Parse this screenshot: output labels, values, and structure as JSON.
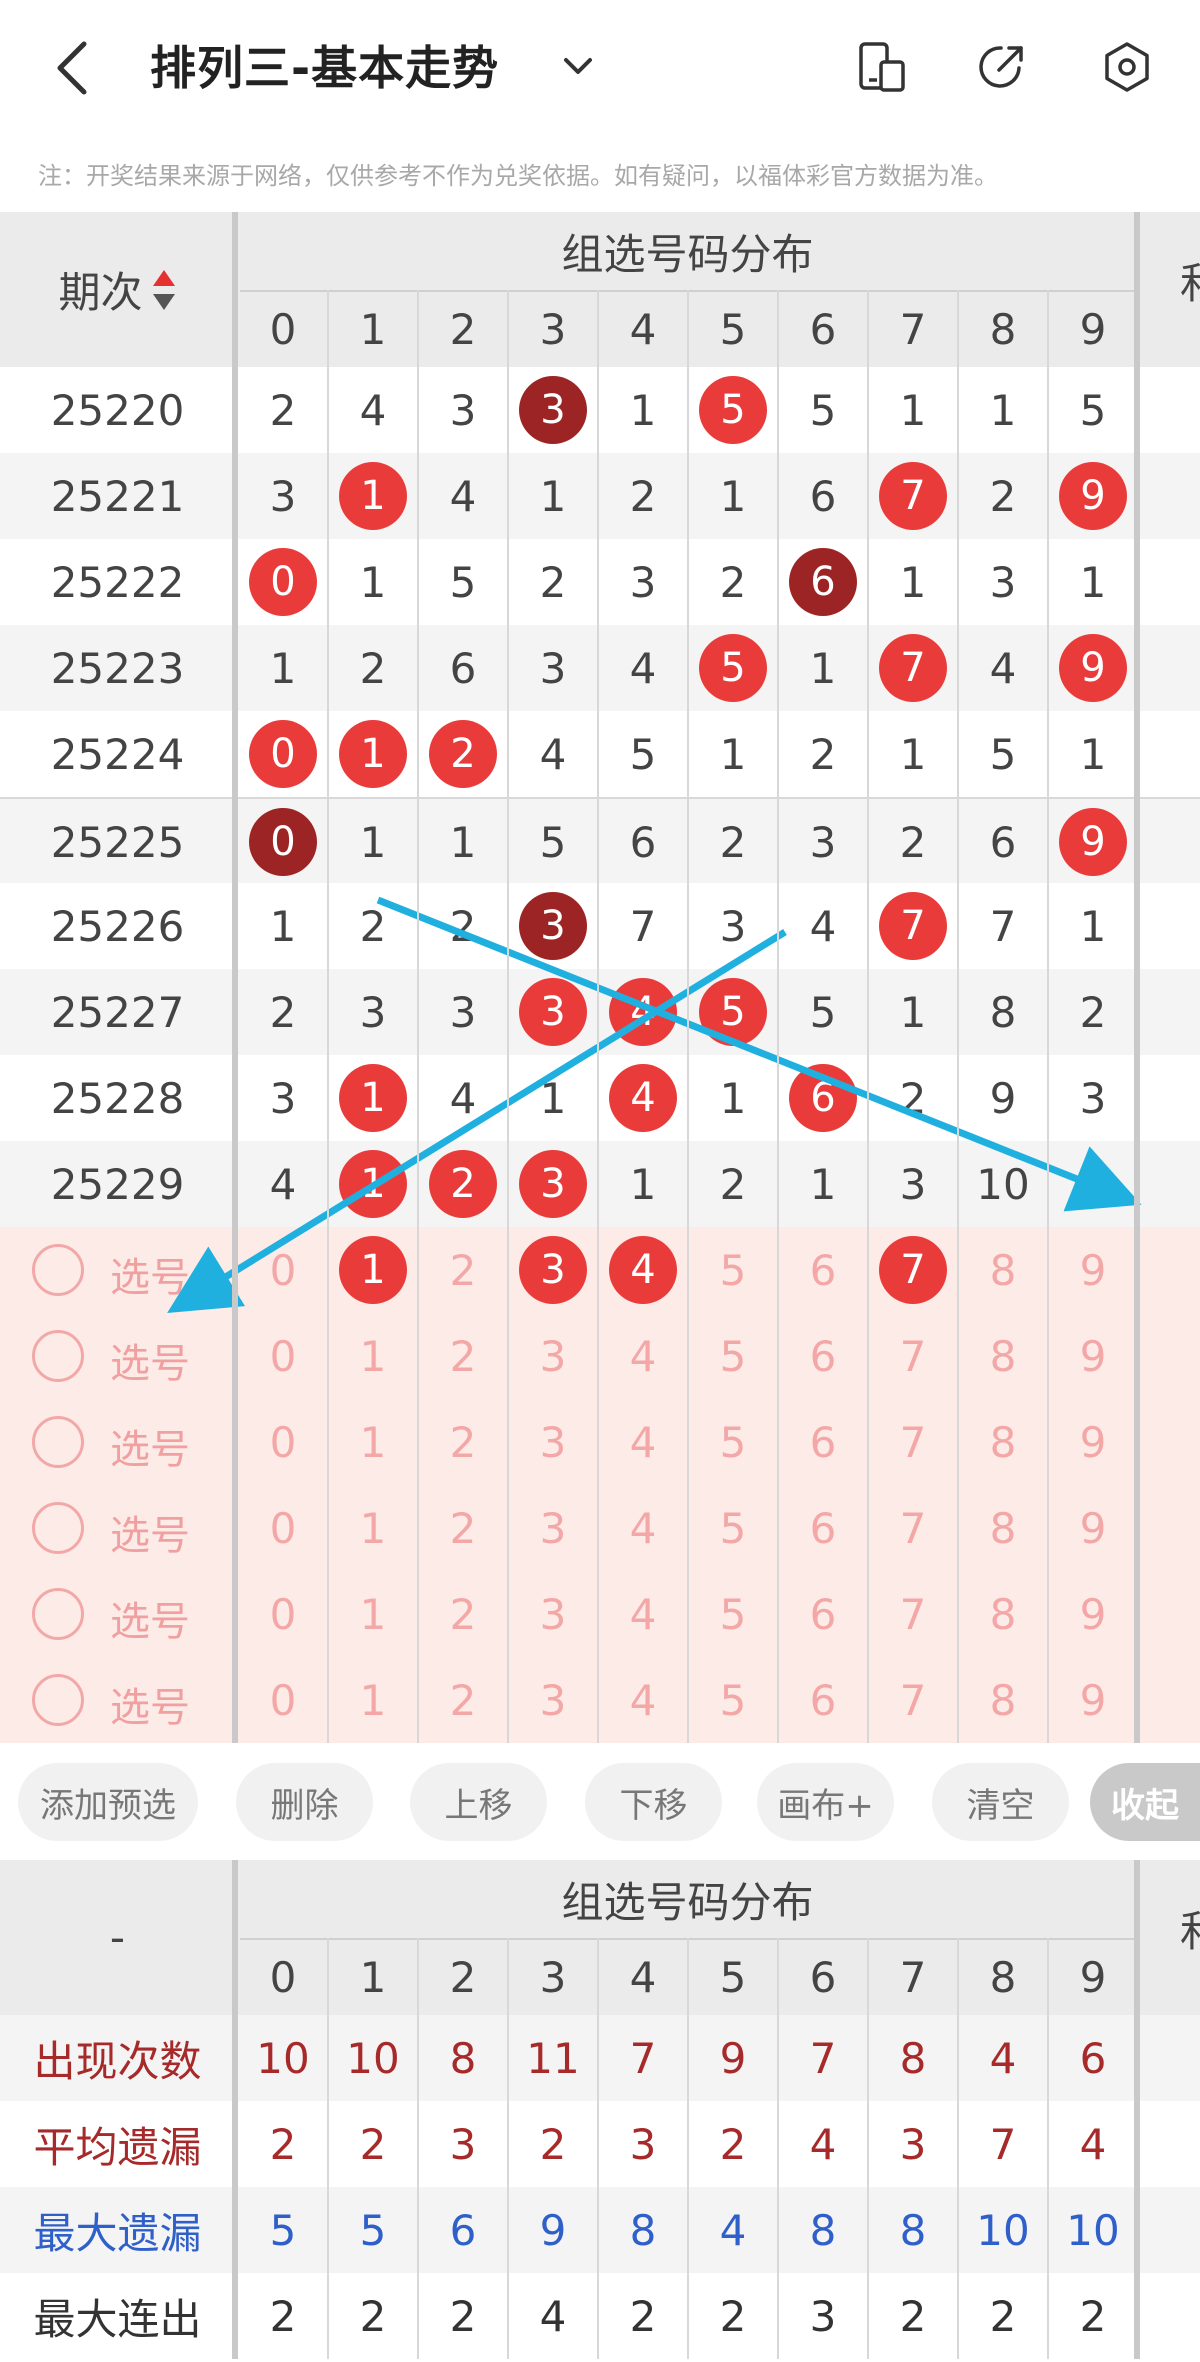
{
  "header": {
    "title": "排列三-基本走势",
    "notice": "注：开奖结果来源于网络，仅供参考不作为兑奖依据。如有疑问，以福体彩官方数据为准。"
  },
  "table": {
    "period_header": "期次",
    "group_header": "组选号码分布",
    "right_clip": "和",
    "digits": [
      "0",
      "1",
      "2",
      "3",
      "4",
      "5",
      "6",
      "7",
      "8",
      "9"
    ],
    "rows": [
      {
        "period": "25220",
        "cells": [
          {
            "v": "2"
          },
          {
            "v": "4"
          },
          {
            "v": "3"
          },
          {
            "v": "3",
            "b": "dark"
          },
          {
            "v": "1"
          },
          {
            "v": "5",
            "b": "red"
          },
          {
            "v": "5"
          },
          {
            "v": "1"
          },
          {
            "v": "1"
          },
          {
            "v": "5"
          }
        ]
      },
      {
        "period": "25221",
        "cells": [
          {
            "v": "3"
          },
          {
            "v": "1",
            "b": "red"
          },
          {
            "v": "4"
          },
          {
            "v": "1"
          },
          {
            "v": "2"
          },
          {
            "v": "1"
          },
          {
            "v": "6"
          },
          {
            "v": "7",
            "b": "red"
          },
          {
            "v": "2"
          },
          {
            "v": "9",
            "b": "red"
          }
        ]
      },
      {
        "period": "25222",
        "cells": [
          {
            "v": "0",
            "b": "red"
          },
          {
            "v": "1"
          },
          {
            "v": "5"
          },
          {
            "v": "2"
          },
          {
            "v": "3"
          },
          {
            "v": "2"
          },
          {
            "v": "6",
            "b": "dark"
          },
          {
            "v": "1"
          },
          {
            "v": "3"
          },
          {
            "v": "1"
          }
        ]
      },
      {
        "period": "25223",
        "cells": [
          {
            "v": "1"
          },
          {
            "v": "2"
          },
          {
            "v": "6"
          },
          {
            "v": "3"
          },
          {
            "v": "4"
          },
          {
            "v": "5",
            "b": "red"
          },
          {
            "v": "1"
          },
          {
            "v": "7",
            "b": "red"
          },
          {
            "v": "4"
          },
          {
            "v": "9",
            "b": "red"
          }
        ]
      },
      {
        "period": "25224",
        "cells": [
          {
            "v": "0",
            "b": "red"
          },
          {
            "v": "1",
            "b": "red"
          },
          {
            "v": "2",
            "b": "red"
          },
          {
            "v": "4"
          },
          {
            "v": "5"
          },
          {
            "v": "1"
          },
          {
            "v": "2"
          },
          {
            "v": "1"
          },
          {
            "v": "5"
          },
          {
            "v": "1"
          }
        ]
      },
      {
        "period": "25225",
        "cells": [
          {
            "v": "0",
            "b": "dark"
          },
          {
            "v": "1"
          },
          {
            "v": "1"
          },
          {
            "v": "5"
          },
          {
            "v": "6"
          },
          {
            "v": "2"
          },
          {
            "v": "3"
          },
          {
            "v": "2"
          },
          {
            "v": "6"
          },
          {
            "v": "9",
            "b": "red"
          }
        ]
      },
      {
        "period": "25226",
        "cells": [
          {
            "v": "1"
          },
          {
            "v": "2"
          },
          {
            "v": "2"
          },
          {
            "v": "3",
            "b": "dark"
          },
          {
            "v": "7"
          },
          {
            "v": "3"
          },
          {
            "v": "4"
          },
          {
            "v": "7",
            "b": "red"
          },
          {
            "v": "7"
          },
          {
            "v": "1"
          }
        ]
      },
      {
        "period": "25227",
        "cells": [
          {
            "v": "2"
          },
          {
            "v": "3"
          },
          {
            "v": "3"
          },
          {
            "v": "3",
            "b": "red"
          },
          {
            "v": "4",
            "b": "red"
          },
          {
            "v": "5",
            "b": "red"
          },
          {
            "v": "5"
          },
          {
            "v": "1"
          },
          {
            "v": "8"
          },
          {
            "v": "2"
          }
        ]
      },
      {
        "period": "25228",
        "cells": [
          {
            "v": "3"
          },
          {
            "v": "1",
            "b": "red"
          },
          {
            "v": "4"
          },
          {
            "v": "1"
          },
          {
            "v": "4",
            "b": "red"
          },
          {
            "v": "1"
          },
          {
            "v": "6",
            "b": "red"
          },
          {
            "v": "2"
          },
          {
            "v": "9"
          },
          {
            "v": "3"
          }
        ]
      },
      {
        "period": "25229",
        "cells": [
          {
            "v": "4"
          },
          {
            "v": "1",
            "b": "red"
          },
          {
            "v": "2",
            "b": "red"
          },
          {
            "v": "3",
            "b": "red"
          },
          {
            "v": "1"
          },
          {
            "v": "2"
          },
          {
            "v": "1"
          },
          {
            "v": "3"
          },
          {
            "v": "10"
          },
          {
            "v": "4"
          }
        ]
      }
    ]
  },
  "selection": {
    "label": "选号",
    "rows": [
      {
        "selected": [
          1,
          3,
          4,
          7
        ]
      },
      {
        "selected": []
      },
      {
        "selected": []
      },
      {
        "selected": []
      },
      {
        "selected": []
      },
      {
        "selected": []
      }
    ]
  },
  "toolbar": {
    "buttons": [
      "添加预选",
      "删除",
      "上移",
      "下移",
      "画布+",
      "清空",
      "收起"
    ]
  },
  "stats": {
    "dash": "-",
    "group_header": "组选号码分布",
    "right_clip": "和",
    "digits": [
      "0",
      "1",
      "2",
      "3",
      "4",
      "5",
      "6",
      "7",
      "8",
      "9"
    ],
    "rows": [
      {
        "label": "出现次数",
        "color": "#a62a2a",
        "values": [
          "10",
          "10",
          "8",
          "11",
          "7",
          "9",
          "7",
          "8",
          "4",
          "6"
        ]
      },
      {
        "label": "平均遗漏",
        "color": "#a62a2a",
        "values": [
          "2",
          "2",
          "3",
          "2",
          "3",
          "2",
          "4",
          "3",
          "7",
          "4"
        ]
      },
      {
        "label": "最大遗漏",
        "color": "#2f5fc8",
        "values": [
          "5",
          "5",
          "6",
          "9",
          "8",
          "4",
          "8",
          "8",
          "10",
          "10"
        ]
      },
      {
        "label": "最大连出",
        "color": "#333333",
        "values": [
          "2",
          "2",
          "2",
          "4",
          "2",
          "2",
          "3",
          "2",
          "2",
          "2"
        ]
      }
    ]
  },
  "colors": {
    "ball_red": "#ea3b3b",
    "ball_dark": "#9d2424",
    "arrow": "#1fb0e0",
    "selection_bg": "#fdebe7"
  }
}
